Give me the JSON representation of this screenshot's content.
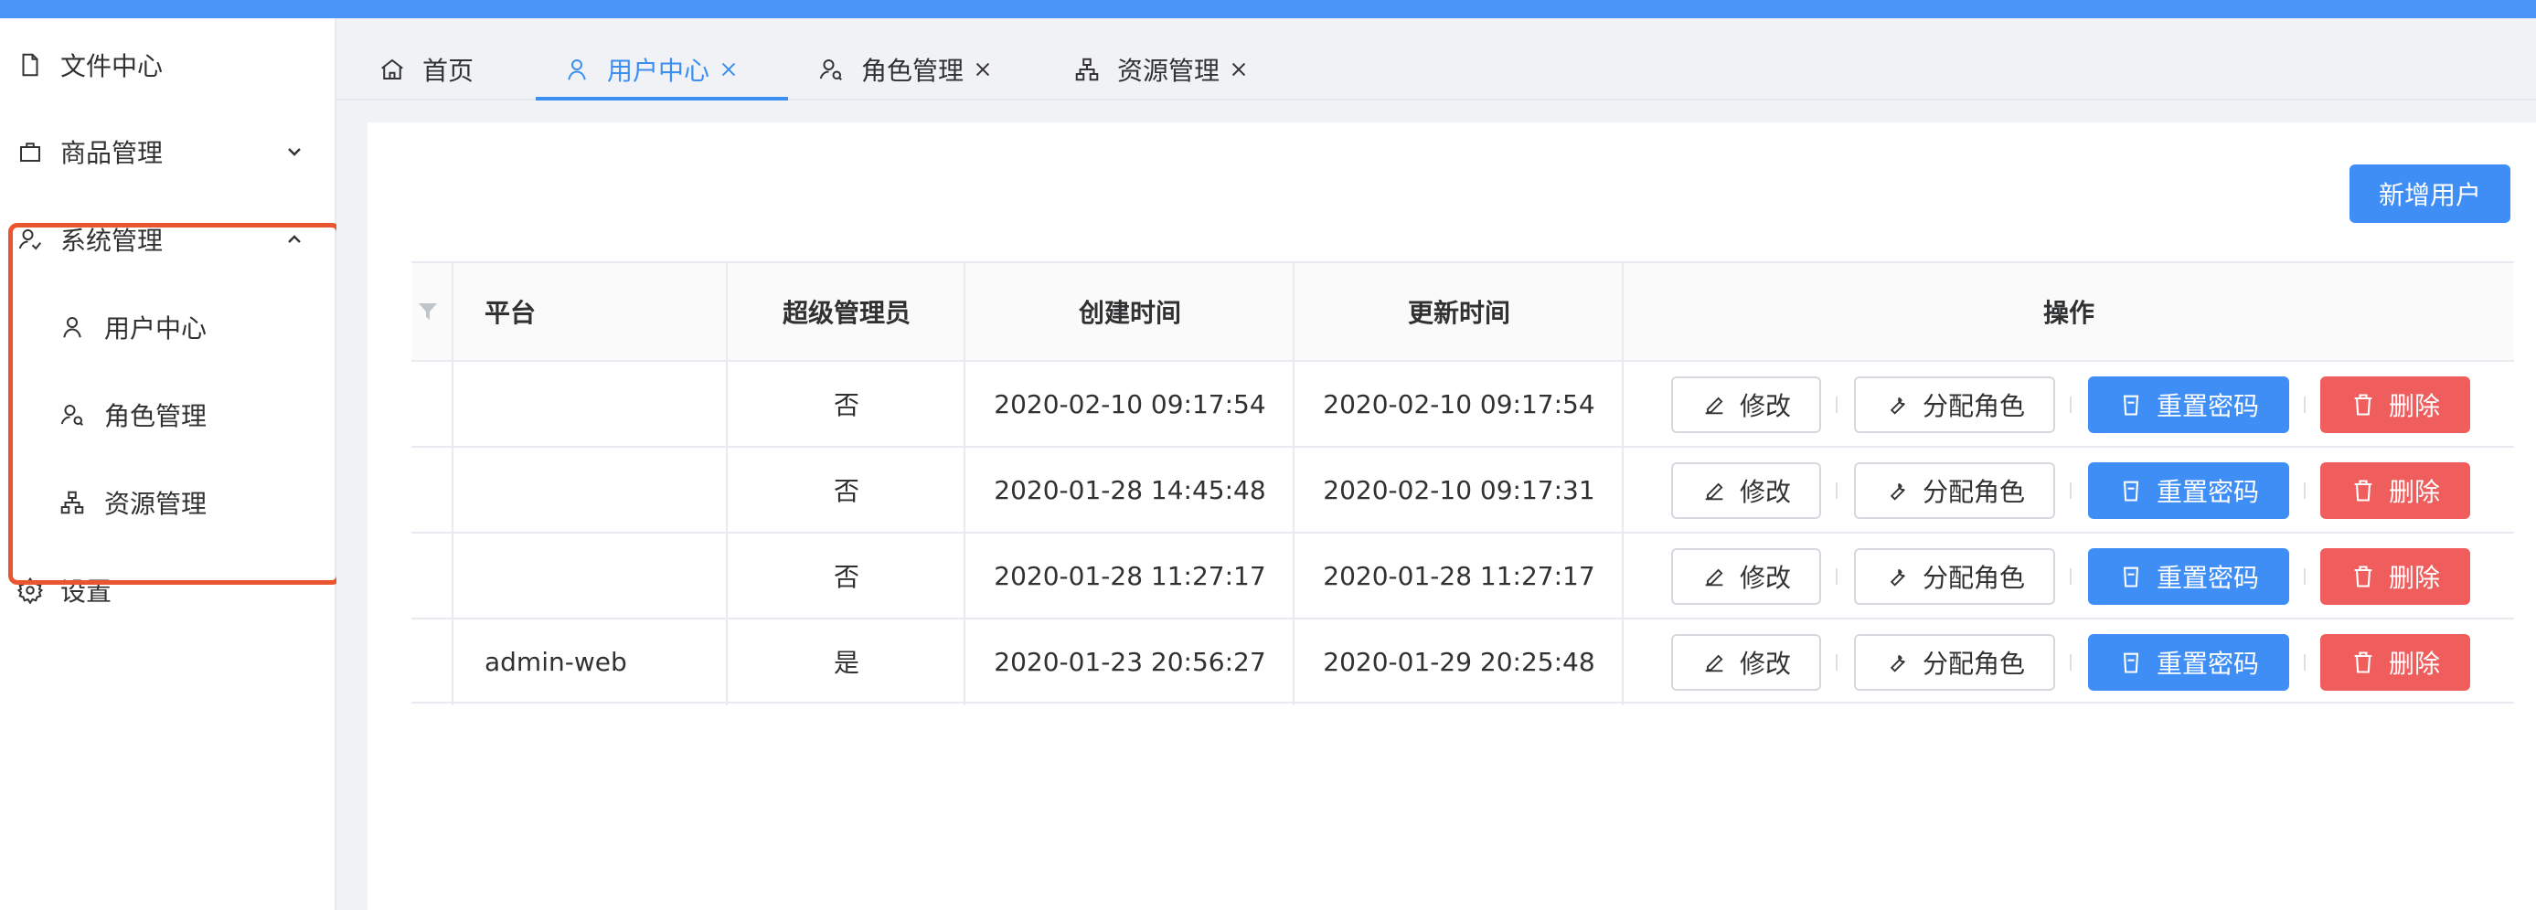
{
  "sidebar": {
    "items": [
      {
        "label": "文件中心",
        "icon": "file-icon"
      },
      {
        "label": "商品管理",
        "icon": "bag-icon",
        "arrow": "chevron-down-icon"
      },
      {
        "label": "系统管理",
        "icon": "users-icon",
        "arrow": "chevron-up-icon"
      },
      {
        "label": "用户中心",
        "icon": "user-icon"
      },
      {
        "label": "角色管理",
        "icon": "role-icon"
      },
      {
        "label": "资源管理",
        "icon": "sitemap-icon"
      },
      {
        "label": "设置",
        "icon": "gear-icon"
      }
    ]
  },
  "tabs": [
    {
      "label": "首页",
      "icon": "home-icon"
    },
    {
      "label": "用户中心",
      "icon": "user-icon",
      "active": true
    },
    {
      "label": "角色管理",
      "icon": "role-icon"
    },
    {
      "label": "资源管理",
      "icon": "sitemap-icon"
    }
  ],
  "toolbar": {
    "add_label": "新增用户"
  },
  "table": {
    "headers": [
      "平台",
      "超级管理员",
      "创建时间",
      "更新时间",
      "操作"
    ],
    "rows": [
      {
        "platform": "",
        "super": "否",
        "created": "2020-02-10 09:17:54",
        "updated": "2020-02-10 09:17:54"
      },
      {
        "platform": "",
        "super": "否",
        "created": "2020-01-28 14:45:48",
        "updated": "2020-02-10 09:17:31"
      },
      {
        "platform": "",
        "super": "否",
        "created": "2020-01-28 11:27:17",
        "updated": "2020-01-28 11:27:17"
      },
      {
        "platform": "admin-web",
        "super": "是",
        "created": "2020-01-23 20:56:27",
        "updated": "2020-01-29 20:25:48"
      }
    ],
    "actions": {
      "edit": "修改",
      "assign_role": "分配角色",
      "reset_password": "重置密码",
      "delete": "删除"
    }
  },
  "colors": {
    "accent": "#3d8ef2",
    "danger": "#ef5d5d",
    "highlight": "#e8552e",
    "topbar": "#4994f6"
  }
}
